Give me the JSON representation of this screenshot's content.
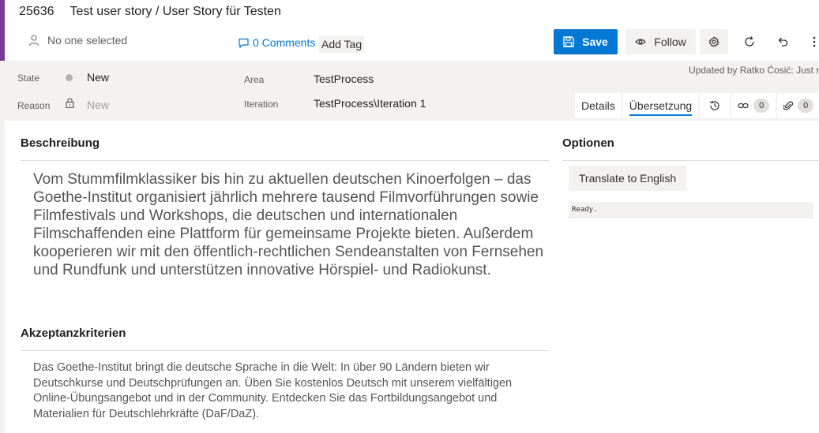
{
  "header": {
    "id": "25636",
    "title": "Test user story / User Story für Testen",
    "assigned": "No one selected",
    "comments": "0 Comments",
    "add_tag": "Add Tag",
    "save": "Save",
    "follow": "Follow",
    "updated": "Updated by Ratko Ćosić: Just now"
  },
  "fields": {
    "state_label": "State",
    "state_value": "New",
    "reason_label": "Reason",
    "reason_value": "New",
    "area_label": "Area",
    "area_value": "TestProcess",
    "iteration_label": "Iteration",
    "iteration_value": "TestProcess\\Iteration 1"
  },
  "tabs": {
    "details": "Details",
    "translation": "Übersetzung",
    "links_count": "0",
    "attachments_count": "0"
  },
  "description": {
    "title": "Beschreibung",
    "text": "Vom Stummfilmklassiker bis hin zu aktuellen deutschen Kinoerfolgen – das Goethe-Institut organisiert jährlich mehrere tausend Filmvorführungen sowie Filmfestivals und Workshops, die deutschen und internationalen Filmschaffenden eine Plattform für gemeinsame Projekte bieten. Außerdem kooperieren wir mit den öffentlich-rechtlichen Sendeanstalten von Fernsehen und Rundfunk und unterstützen innovative Hörspiel- und Radiokunst."
  },
  "acceptance": {
    "title": "Akzeptanzkriterien",
    "text": "Das Goethe-Institut bringt die deutsche Sprache in die Welt: In über 90 Ländern bieten wir Deutschkurse und Deutschprüfungen an. Üben Sie kostenlos Deutsch mit unserem vielfältigen Online-Übungsangebot und in der Community. Entdecken Sie das Fortbildungsangebot und Materialien für Deutschlehrkräfte (DaF/DaZ)."
  },
  "options": {
    "title": "Optionen",
    "translate_button": "Translate to English",
    "status": "Ready."
  },
  "colors": {
    "accent": "#773b93",
    "primary": "#0078d4"
  }
}
